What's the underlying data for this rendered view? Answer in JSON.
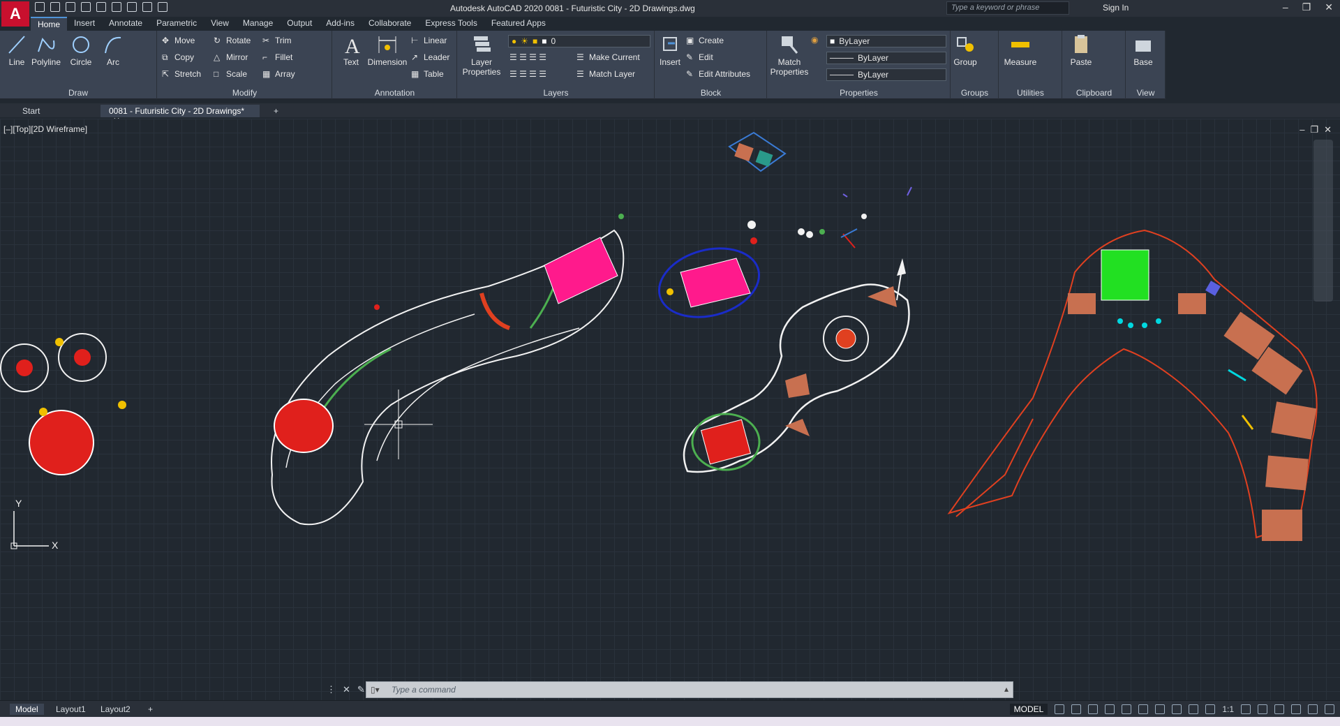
{
  "app": {
    "logo_letter": "A",
    "title": "Autodesk AutoCAD 2020   0081 - Futuristic City - 2D Drawings.dwg",
    "search_placeholder": "Type a keyword or phrase",
    "sign_in": "Sign In"
  },
  "menu_tabs": [
    "Home",
    "Insert",
    "Annotate",
    "Parametric",
    "View",
    "Manage",
    "Output",
    "Add-ins",
    "Collaborate",
    "Express Tools",
    "Featured Apps"
  ],
  "ribbon": {
    "draw": {
      "title": "Draw",
      "line": "Line",
      "polyline": "Polyline",
      "circle": "Circle",
      "arc": "Arc"
    },
    "modify": {
      "title": "Modify",
      "move": "Move",
      "rotate": "Rotate",
      "trim": "Trim",
      "copy": "Copy",
      "mirror": "Mirror",
      "fillet": "Fillet",
      "stretch": "Stretch",
      "scale": "Scale",
      "array": "Array"
    },
    "annotation": {
      "title": "Annotation",
      "text": "Text",
      "dimension": "Dimension",
      "linear": "Linear",
      "leader": "Leader",
      "table": "Table"
    },
    "layers": {
      "title": "Layers",
      "layer_properties": "Layer Properties",
      "current_layer": "0",
      "make_current": "Make Current",
      "match_layer": "Match Layer"
    },
    "block": {
      "title": "Block",
      "insert": "Insert",
      "create": "Create",
      "edit": "Edit",
      "edit_attributes": "Edit Attributes"
    },
    "properties": {
      "title": "Properties",
      "match_properties": "Match Properties",
      "color": "ByLayer",
      "linetype": "ByLayer",
      "lineweight": "ByLayer"
    },
    "groups": {
      "title": "Groups",
      "group": "Group"
    },
    "utilities": {
      "title": "Utilities",
      "measure": "Measure"
    },
    "clipboard": {
      "title": "Clipboard",
      "paste": "Paste"
    },
    "view": {
      "title": "View",
      "base": "Base"
    }
  },
  "doc_tabs": {
    "start": "Start",
    "active": "0081 - Futuristic City - 2D Drawings*"
  },
  "viewport": {
    "label": "[–][Top][2D Wireframe]"
  },
  "command": {
    "placeholder": "Type a command"
  },
  "layout_tabs": [
    "Model",
    "Layout1",
    "Layout2"
  ],
  "status": {
    "space": "MODEL",
    "scale": "1:1"
  },
  "ucs": {
    "x": "X",
    "y": "Y"
  }
}
